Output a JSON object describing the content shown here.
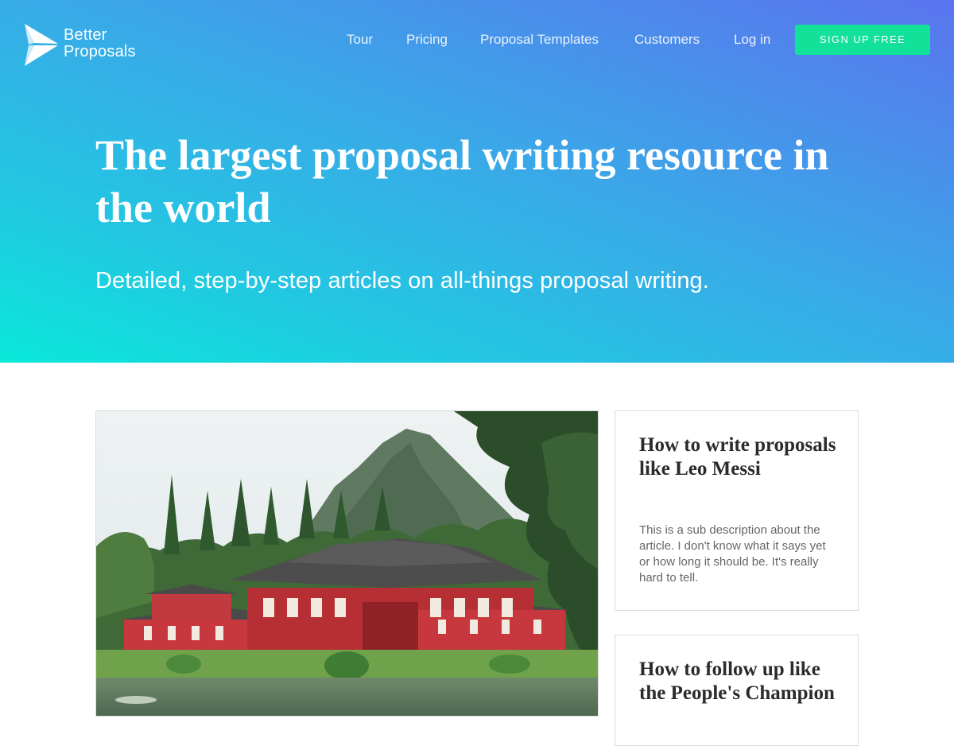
{
  "brand": {
    "line1": "Better",
    "line2": "Proposals"
  },
  "nav": {
    "items": [
      {
        "label": "Tour"
      },
      {
        "label": "Pricing"
      },
      {
        "label": "Proposal Templates"
      },
      {
        "label": "Customers"
      },
      {
        "label": "Log in"
      }
    ],
    "cta_label": "SIGN UP FREE"
  },
  "hero": {
    "title": "The largest proposal writing resource in the world",
    "subtitle": "Detailed, step-by-step articles on all-things proposal writing."
  },
  "featured": {
    "image": "japanese-temple-photo"
  },
  "articles": [
    {
      "title": "How to write proposals like Leo Messi",
      "description": "This is a sub description about the article. I don't know what it says yet or how long it should be. It's really hard to tell."
    },
    {
      "title": "How to follow up like the People's Champion"
    }
  ],
  "colors": {
    "gradient_start": "#0ae8d9",
    "gradient_end": "#5a74ee",
    "cta": "#12e19a"
  }
}
